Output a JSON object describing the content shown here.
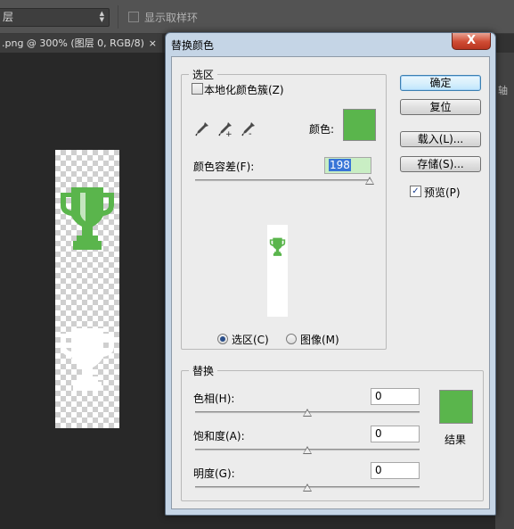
{
  "ps": {
    "layer_select_value": "层",
    "sample_ring_label": "显示取样环",
    "doc_tab_label": ".png @ 300% (图层 0, RGB/8)",
    "doc_tab_close": "×",
    "right_panel_text": "轴"
  },
  "dialog": {
    "title": "替换颜色",
    "close_label": "X",
    "selection": {
      "legend": "选区",
      "localized_clusters_label": "本地化颜色簇(Z)",
      "localized_clusters_checked": false,
      "color_label": "颜色:",
      "color_value": "#5ab54c",
      "fuzziness_label": "颜色容差(F):",
      "fuzziness_value": "198",
      "fuzziness_fraction": 0.99,
      "radio_selection_label": "选区(C)",
      "radio_image_label": "图像(M)",
      "selected_view": "选区(C)"
    },
    "replace": {
      "legend": "替换",
      "hue_label": "色相(H):",
      "hue_value": "0",
      "saturation_label": "饱和度(A):",
      "saturation_value": "0",
      "lightness_label": "明度(G):",
      "lightness_value": "0",
      "result_label": "结果",
      "result_color": "#5ab54c"
    },
    "buttons": {
      "ok": "确定",
      "reset": "复位",
      "load": "载入(L)...",
      "save": "存储(S)...",
      "preview_label": "预览(P)",
      "preview_checked": true
    }
  },
  "colors": {
    "trophy_green": "#5ab54c",
    "accent_blue": "#3875d7"
  }
}
